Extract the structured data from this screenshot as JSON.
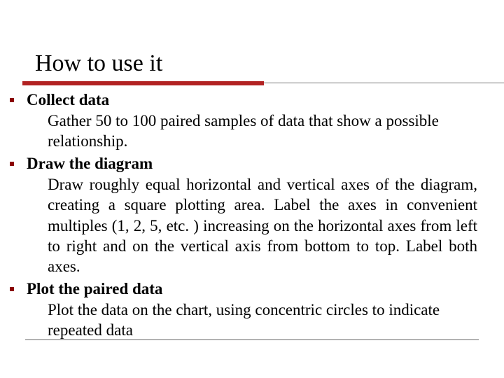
{
  "title": "How to use it",
  "items": [
    {
      "heading": "Collect data",
      "desc": "Gather 50 to 100 paired samples of data that show a possible relationship."
    },
    {
      "heading": "Draw the diagram",
      "desc": "Draw roughly equal horizontal and vertical axes of the diagram, creating a square plotting area. Label the axes in convenient multiples (1, 2, 5, etc. ) increasing on the horizontal axes from left to right and on the vertical axis from bottom to top. Label both axes."
    },
    {
      "heading": "Plot the paired data",
      "desc": "Plot the data on the chart, using concentric circles to indicate repeated data"
    }
  ]
}
